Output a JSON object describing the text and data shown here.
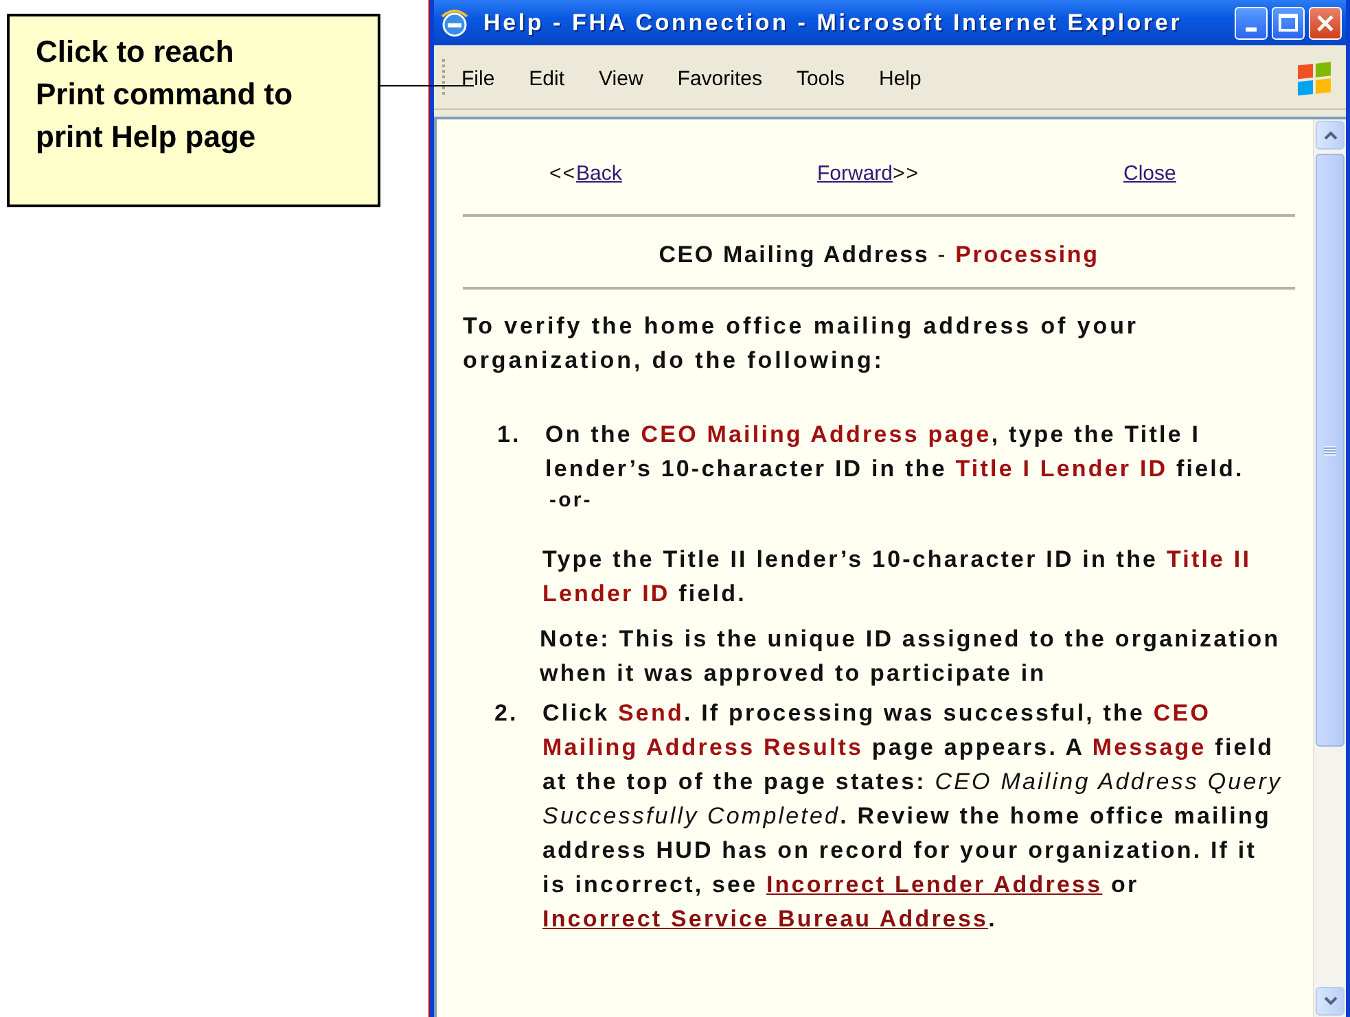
{
  "callout": {
    "lines": [
      "Click to reach",
      "Print command to",
      "print Help page"
    ]
  },
  "window": {
    "title": "Help - FHA Connection - Microsoft Internet Explorer"
  },
  "menu_bar": {
    "items": [
      "File",
      "Edit",
      "View",
      "Favorites",
      "Tools",
      "Help"
    ]
  },
  "nav": [
    {
      "prefix": "<<",
      "label": "Back"
    },
    {
      "label": "Forward",
      "suffix": ">>"
    },
    {
      "label": "Close"
    }
  ],
  "heading": [
    {
      "kind": "text",
      "text": "CEO Mailing Address"
    },
    {
      "kind": "light",
      "text": " - "
    },
    {
      "kind": "term",
      "text": "Processing"
    }
  ],
  "intro": [
    {
      "kind": "text",
      "text": "To verify the home office mailing address of your organization, do the following:"
    }
  ],
  "steps": [
    {
      "number": "1.",
      "blocks": [
        {
          "kind": "main",
          "segments": [
            {
              "kind": "text",
              "text": "On the "
            },
            {
              "kind": "term",
              "text": "CEO Mailing Address page"
            },
            {
              "kind": "text",
              "text": ", type the Title I lender’s 10-character ID in the "
            },
            {
              "kind": "term",
              "text": "Title I Lender ID"
            },
            {
              "kind": "text",
              "text": " field."
            }
          ]
        },
        {
          "kind": "separator",
          "segments": [
            {
              "kind": "text",
              "text": "-or-"
            }
          ]
        },
        {
          "kind": "alternative",
          "segments": [
            {
              "kind": "text",
              "text": "Type the Title II lender’s 10-character ID in the "
            },
            {
              "kind": "term",
              "text": "Title II Lender ID"
            },
            {
              "kind": "text",
              "text": " field."
            }
          ]
        },
        {
          "kind": "note",
          "segments": [
            {
              "kind": "text",
              "text": "Note: This is the unique ID assigned to the organization when it was approved to participate in"
            }
          ]
        }
      ]
    },
    {
      "number": "2.",
      "blocks": [
        {
          "kind": "main",
          "segments": [
            {
              "kind": "text",
              "text": "Click "
            },
            {
              "kind": "term",
              "text": "Send"
            },
            {
              "kind": "text",
              "text": ". If processing was successful, the "
            },
            {
              "kind": "term",
              "text": "CEO Mailing Address Results"
            },
            {
              "kind": "text",
              "text": " page appears. A "
            },
            {
              "kind": "term",
              "text": "Message"
            },
            {
              "kind": "text",
              "text": " field at the top of the page states: "
            },
            {
              "kind": "emphasis",
              "text": "CEO Mailing Address Query Successfully Completed"
            },
            {
              "kind": "text",
              "text": ". Review the home office mailing address HUD has on record for your organization. If it is incorrect, see "
            },
            {
              "kind": "link",
              "text": "Incorrect Lender Address"
            },
            {
              "kind": "text",
              "text": " or "
            },
            {
              "kind": "link",
              "text": "Incorrect Service Bureau Address"
            },
            {
              "kind": "text",
              "text": "."
            }
          ]
        }
      ]
    }
  ]
}
